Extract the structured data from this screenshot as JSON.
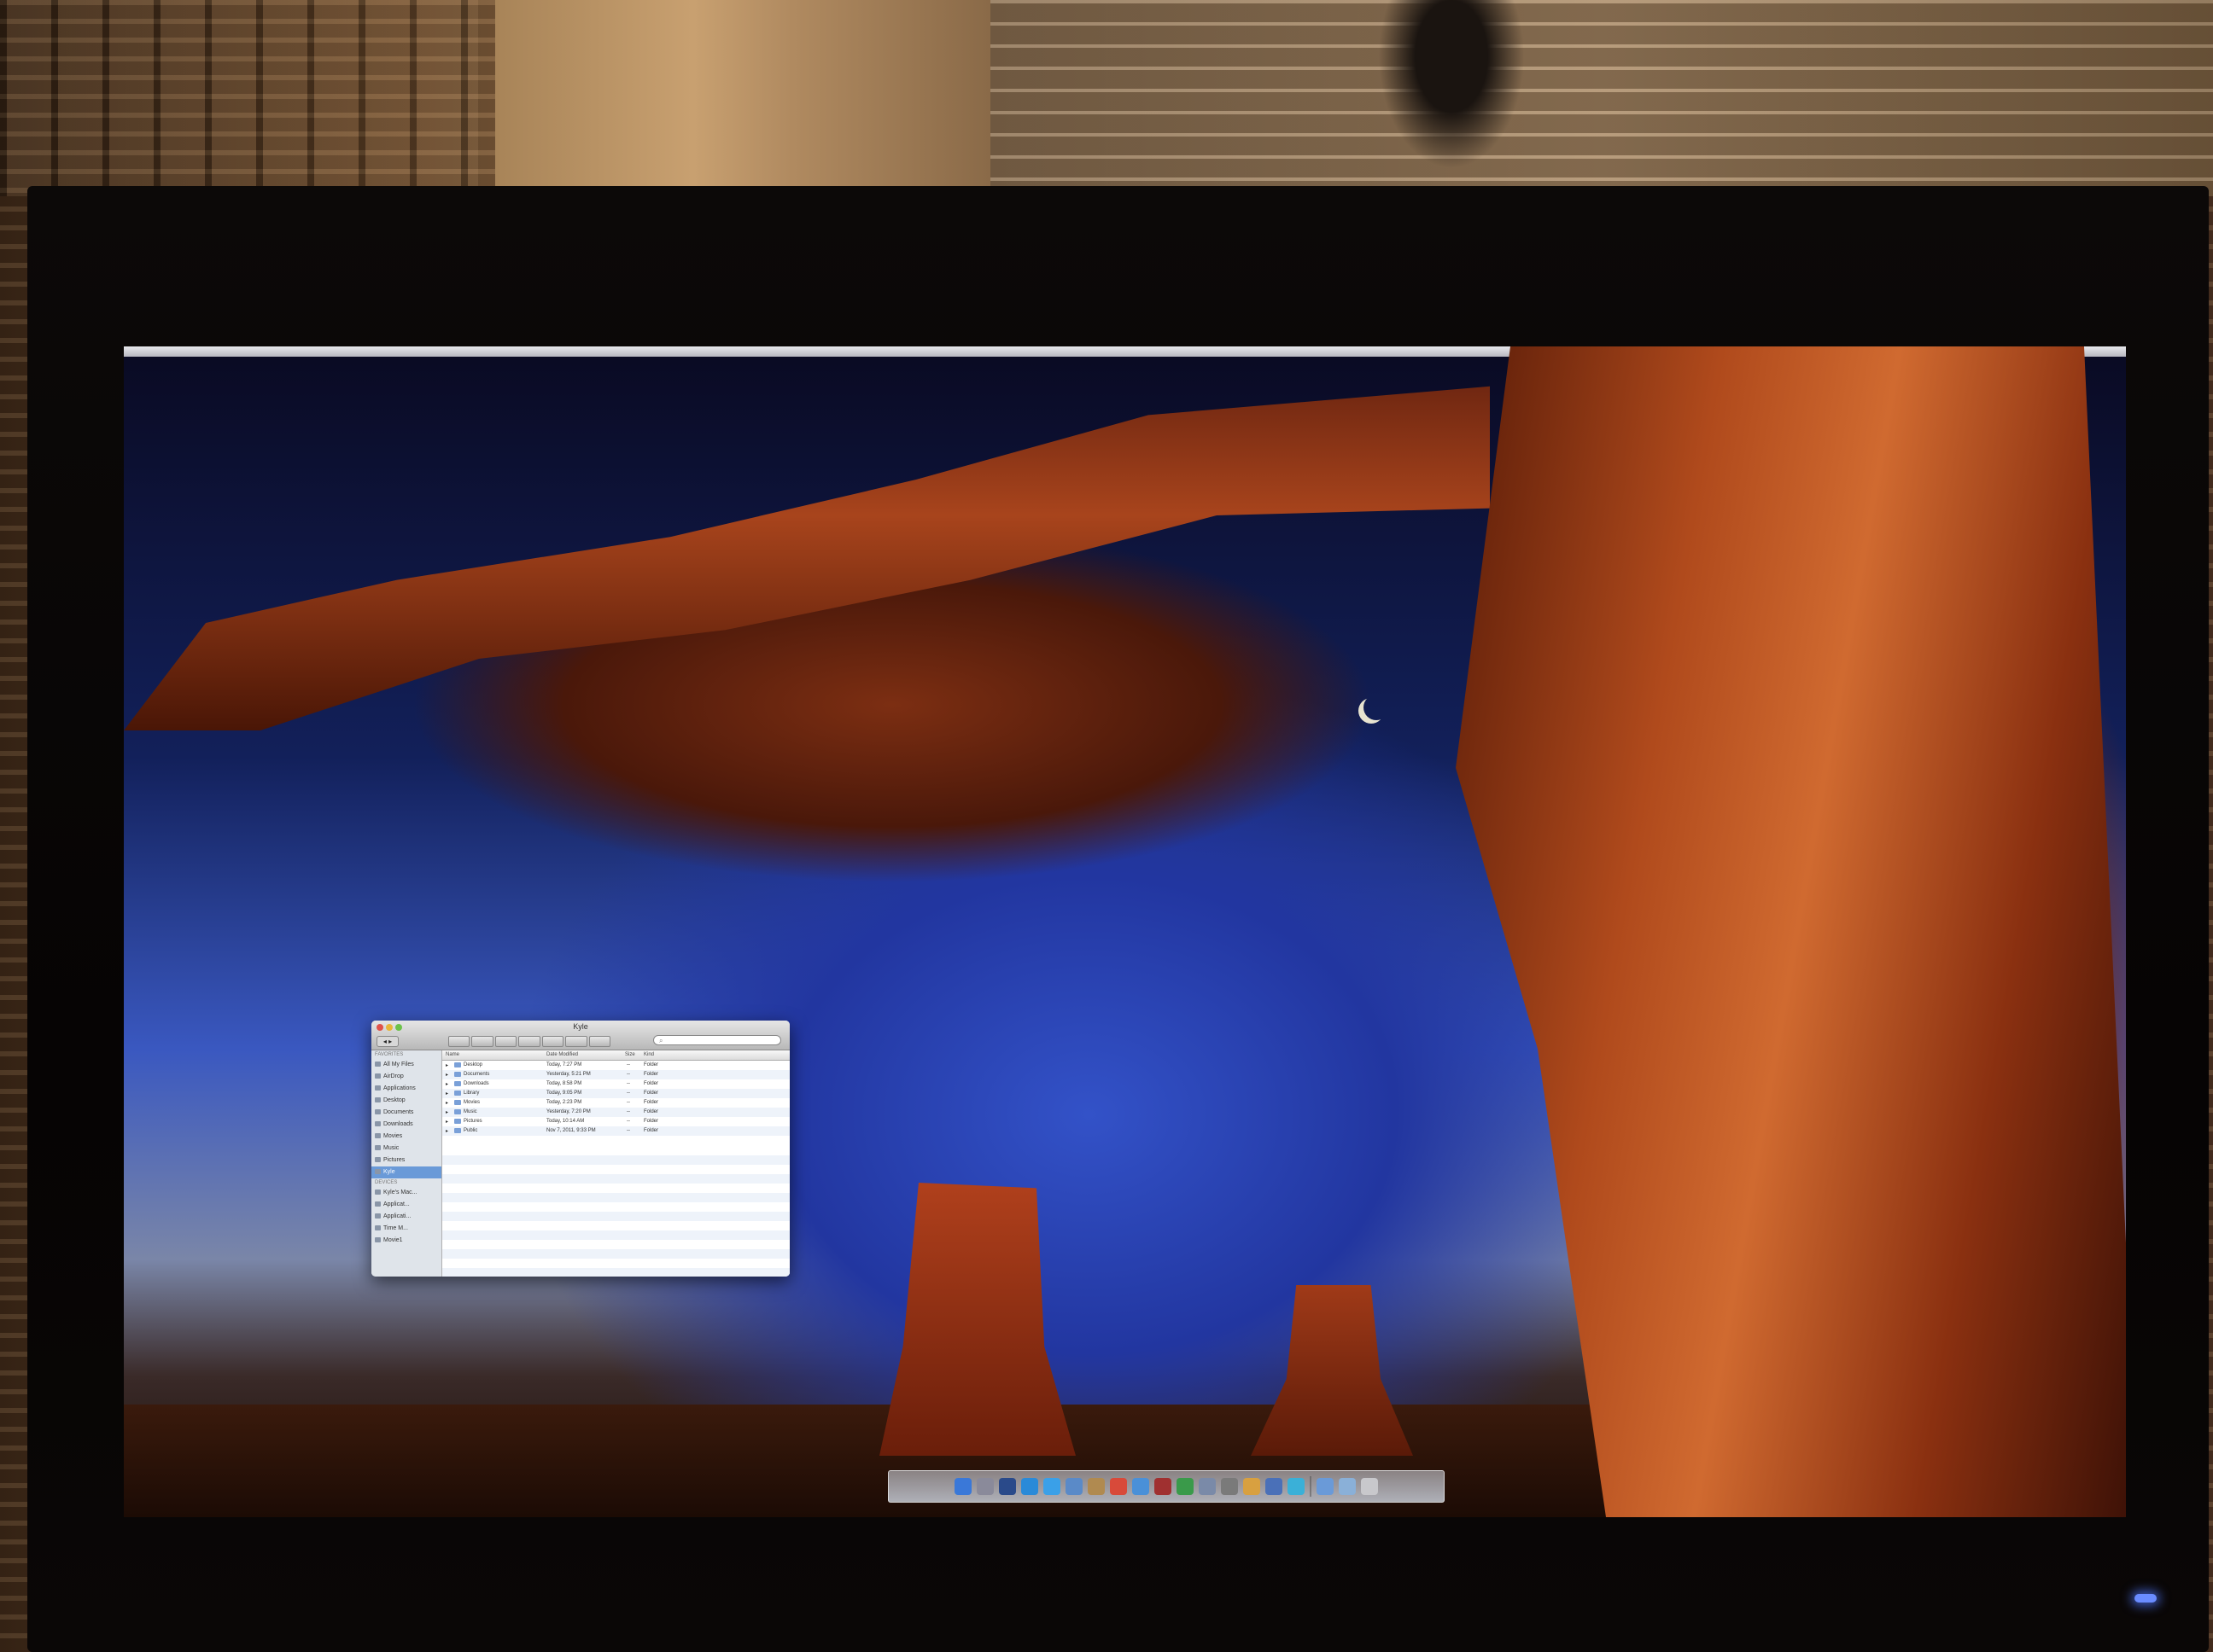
{
  "finder": {
    "title": "Kyle",
    "search_placeholder": "",
    "nav_label": "◂ ▸",
    "sidebar": {
      "favorites_header": "FAVORITES",
      "favorites": [
        "All My Files",
        "AirDrop",
        "Applications",
        "Desktop",
        "Documents",
        "Downloads",
        "Movies",
        "Music",
        "Pictures",
        "Kyle"
      ],
      "devices_header": "DEVICES",
      "devices": [
        "Kyle's Mac...",
        "Applicat...",
        "Applicati...",
        "Time M...",
        "Movie1"
      ]
    },
    "columns": {
      "name": "Name",
      "date": "Date Modified",
      "size": "Size",
      "kind": "Kind"
    },
    "files": [
      {
        "name": "Desktop",
        "date": "Today, 7:27 PM",
        "size": "--",
        "kind": "Folder"
      },
      {
        "name": "Documents",
        "date": "Yesterday, 5:21 PM",
        "size": "--",
        "kind": "Folder"
      },
      {
        "name": "Downloads",
        "date": "Today, 8:58 PM",
        "size": "--",
        "kind": "Folder"
      },
      {
        "name": "Library",
        "date": "Today, 9:05 PM",
        "size": "--",
        "kind": "Folder"
      },
      {
        "name": "Movies",
        "date": "Today, 2:23 PM",
        "size": "--",
        "kind": "Folder"
      },
      {
        "name": "Music",
        "date": "Yesterday, 7:20 PM",
        "size": "--",
        "kind": "Folder"
      },
      {
        "name": "Pictures",
        "date": "Today, 10:14 AM",
        "size": "--",
        "kind": "Folder"
      },
      {
        "name": "Public",
        "date": "Nov 7, 2011, 9:33 PM",
        "size": "--",
        "kind": "Folder"
      }
    ]
  },
  "dock": {
    "icons": [
      {
        "name": "finder-icon",
        "color": "#3a78d8"
      },
      {
        "name": "launchpad-icon",
        "color": "#8a8a9a"
      },
      {
        "name": "mission-control-icon",
        "color": "#2a4a8a"
      },
      {
        "name": "app-store-icon",
        "color": "#2a8ad8"
      },
      {
        "name": "safari-icon",
        "color": "#3aa0e8"
      },
      {
        "name": "mail-icon",
        "color": "#5a8ac8"
      },
      {
        "name": "contacts-icon",
        "color": "#b08a50"
      },
      {
        "name": "ical-icon",
        "color": "#d84a3a"
      },
      {
        "name": "itunes-icon",
        "color": "#4a90d8"
      },
      {
        "name": "photo-booth-icon",
        "color": "#a03030"
      },
      {
        "name": "facetime-icon",
        "color": "#3a9a4a"
      },
      {
        "name": "preview-icon",
        "color": "#7a8aa8"
      },
      {
        "name": "system-preferences-icon",
        "color": "#7a7a7a"
      },
      {
        "name": "utility-icon",
        "color": "#d8a040"
      },
      {
        "name": "xcode-icon",
        "color": "#4a70b8"
      },
      {
        "name": "app-icon",
        "color": "#3ab0d8"
      }
    ],
    "right_icons": [
      {
        "name": "applications-stack-icon",
        "color": "#6a9ad8"
      },
      {
        "name": "documents-stack-icon",
        "color": "#8ab0d8"
      },
      {
        "name": "trash-icon",
        "color": "#c8c8cc"
      }
    ]
  },
  "monitor": {
    "brand": ""
  }
}
